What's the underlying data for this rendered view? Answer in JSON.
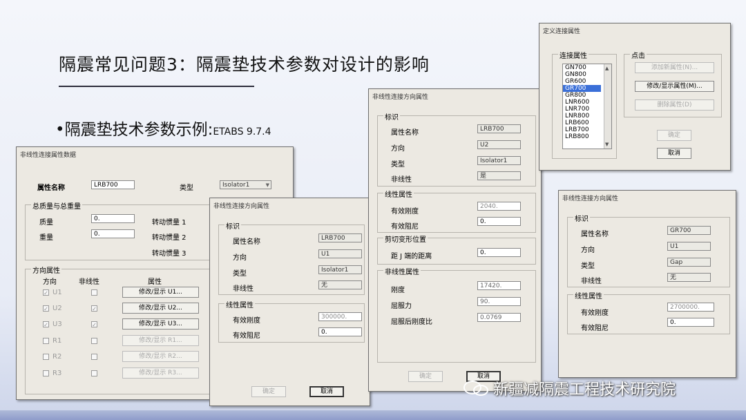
{
  "slide": {
    "title": "隔震常见问题3：隔震垫技术参数对设计的影响",
    "bullet_main": "•隔震垫技术参数示例:",
    "bullet_small": "ETABS 9.7.4"
  },
  "win1": {
    "title": "非线性连接属性数据",
    "prop_name_label": "属性名称",
    "prop_name_value": "LRB700",
    "type_label": "类型",
    "type_value": "Isolator1",
    "mass_group": "总质量与总重量",
    "mass_label": "质量",
    "mass_value": "0.",
    "weight_label": "重量",
    "weight_value": "0.",
    "rot1": "转动惯量 1",
    "rot2": "转动惯量 2",
    "rot3": "转动惯量 3",
    "dir_group": "方向属性",
    "col_dir": "方向",
    "col_nl": "非线性",
    "col_prop": "属性",
    "rows": [
      {
        "dir": "U1",
        "btn": "修改/显示 U1..."
      },
      {
        "dir": "U2",
        "btn": "修改/显示 U2..."
      },
      {
        "dir": "U3",
        "btn": "修改/显示 U3..."
      },
      {
        "dir": "R1",
        "btn": "修改/显示 R1..."
      },
      {
        "dir": "R2",
        "btn": "修改/显示 R2..."
      },
      {
        "dir": "R3",
        "btn": "修改/显示 R3..."
      }
    ]
  },
  "win2": {
    "title": "非线性连接方向属性",
    "ident_group": "标识",
    "name_label": "属性名称",
    "name_value": "LRB700",
    "dir_label": "方向",
    "dir_value": "U1",
    "type_label": "类型",
    "type_value": "Isolator1",
    "nl_label": "非线性",
    "nl_value": "无",
    "lin_group": "线性属性",
    "eff_stiff_label": "有效刚度",
    "eff_stiff_value": "300000.",
    "eff_damp_label": "有效阻尼",
    "eff_damp_value": "0.",
    "ok": "确定",
    "cancel": "取消"
  },
  "win3": {
    "title": "非线性连接方向属性",
    "ident_group": "标识",
    "name_label": "属性名称",
    "name_value": "LRB700",
    "dir_label": "方向",
    "dir_value": "U2",
    "type_label": "类型",
    "type_value": "Isolator1",
    "nl_label": "非线性",
    "nl_value": "是",
    "lin_group": "线性属性",
    "eff_stiff_label": "有效刚度",
    "eff_stiff_value": "2040.",
    "eff_damp_label": "有效阻尼",
    "eff_damp_value": "0.",
    "shear_group": "剪切变形位置",
    "dist_label": "距 J 端的距离",
    "dist_value": "0.",
    "nonlin_group": "非线性属性",
    "stiff_label": "刚度",
    "stiff_value": "17420.",
    "yield_label": "屈服力",
    "yield_value": "90.",
    "ratio_label": "屈服后刚度比",
    "ratio_value": "0.0769",
    "ok": "确定",
    "cancel": "取消"
  },
  "win4": {
    "title": "定义连接属性",
    "list_group": "连接属性",
    "items": [
      "GN700",
      "GN800",
      "GR600",
      "GR700",
      "GR800",
      "LNR600",
      "LNR700",
      "LNR800",
      "LRB600",
      "LRB700",
      "LRB800"
    ],
    "selected_item": "GR700",
    "click_group": "点击",
    "add_btn": "添加新属性(N)...",
    "modify_btn": "修改/显示属性(M)...",
    "delete_btn": "删除属性(D)",
    "ok": "确定",
    "cancel": "取消"
  },
  "win5": {
    "title": "非线性连接方向属性",
    "ident_group": "标识",
    "name_label": "属性名称",
    "name_value": "GR700",
    "dir_label": "方向",
    "dir_value": "U1",
    "type_label": "类型",
    "type_value": "Gap",
    "nl_label": "非线性",
    "nl_value": "无",
    "lin_group": "线性属性",
    "eff_stiff_label": "有效刚度",
    "eff_stiff_value": "2700000.",
    "eff_damp_label": "有效阻尼",
    "eff_damp_value": "0."
  },
  "watermark": "新疆减隔震工程技术研究院"
}
